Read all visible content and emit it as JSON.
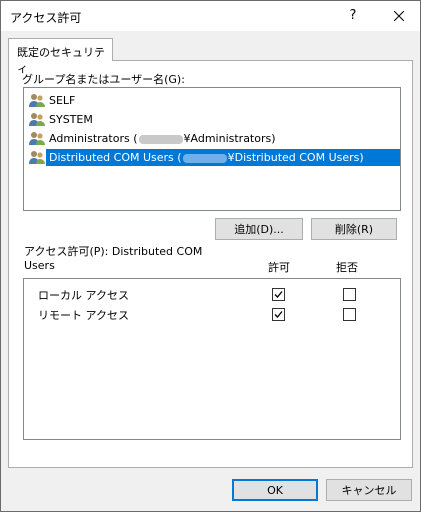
{
  "window": {
    "title": "アクセス許可",
    "help_label": "?",
    "close_label": "✕"
  },
  "tab": {
    "label": "既定のセキュリティ"
  },
  "groups": {
    "label": "グループ名またはユーザー名(G):",
    "items": [
      {
        "before": "SELF",
        "after": "",
        "selected": false
      },
      {
        "before": "SYSTEM",
        "after": "",
        "selected": false
      },
      {
        "before": "Administrators (",
        "after": "¥Administrators)",
        "selected": false
      },
      {
        "before": "Distributed COM Users (",
        "after": "¥Distributed COM Users)",
        "selected": true
      }
    ]
  },
  "buttons": {
    "add": "追加(D)...",
    "remove": "削除(R)",
    "ok": "OK",
    "cancel": "キャンセル"
  },
  "permissions": {
    "label_line1": "アクセス許可(P): Distributed COM",
    "label_line2": "Users",
    "allow_header": "許可",
    "deny_header": "拒否",
    "rows": [
      {
        "name": "ローカル アクセス",
        "allow": true,
        "deny": false
      },
      {
        "name": "リモート アクセス",
        "allow": true,
        "deny": false
      }
    ]
  },
  "icons": {
    "group": "users-group-icon",
    "check": "checkmark-icon"
  },
  "colors": {
    "selection": "#0078d7",
    "default_button_border": "#0078d7"
  }
}
